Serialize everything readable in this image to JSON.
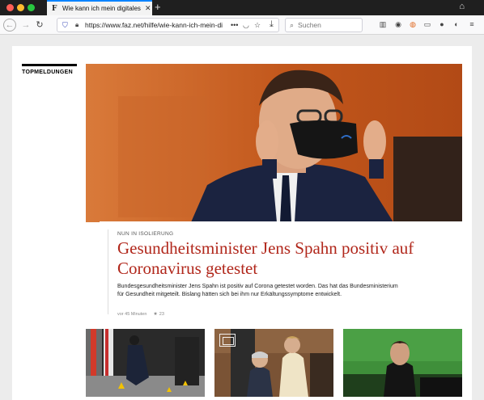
{
  "browser": {
    "tab_title": "Wie kann ich mein digitales Abo",
    "tab_favicon": "F",
    "url": "https://www.faz.net/hilfe/wie-kann-ich-mein-di",
    "search_placeholder": "Suchen",
    "icons": [
      "library-icon",
      "account-icon",
      "addon-icon",
      "sidebar-icon",
      "profile-icon",
      "extension-icon",
      "menu-icon"
    ]
  },
  "section": {
    "label": "TOPMELDUNGEN"
  },
  "article": {
    "kicker": "NUN IN ISOLIERUNG",
    "headline": "Gesundheitsminister Jens Spahn positiv auf Coronavirus getestet",
    "teaser": "Bundesgesundheitsminister Jens Spahn ist positiv auf Corona getestet worden. Das hat das Bundesministerium für Gesundheit mitgeteilt. Bislang hätten sich bei ihm nur Erkältungssymptome entwickelt.",
    "time": "vor 45 Minuten",
    "comments": "23"
  },
  "colors": {
    "headline": "#b1271b",
    "accent_tab": "#0a84ff"
  }
}
